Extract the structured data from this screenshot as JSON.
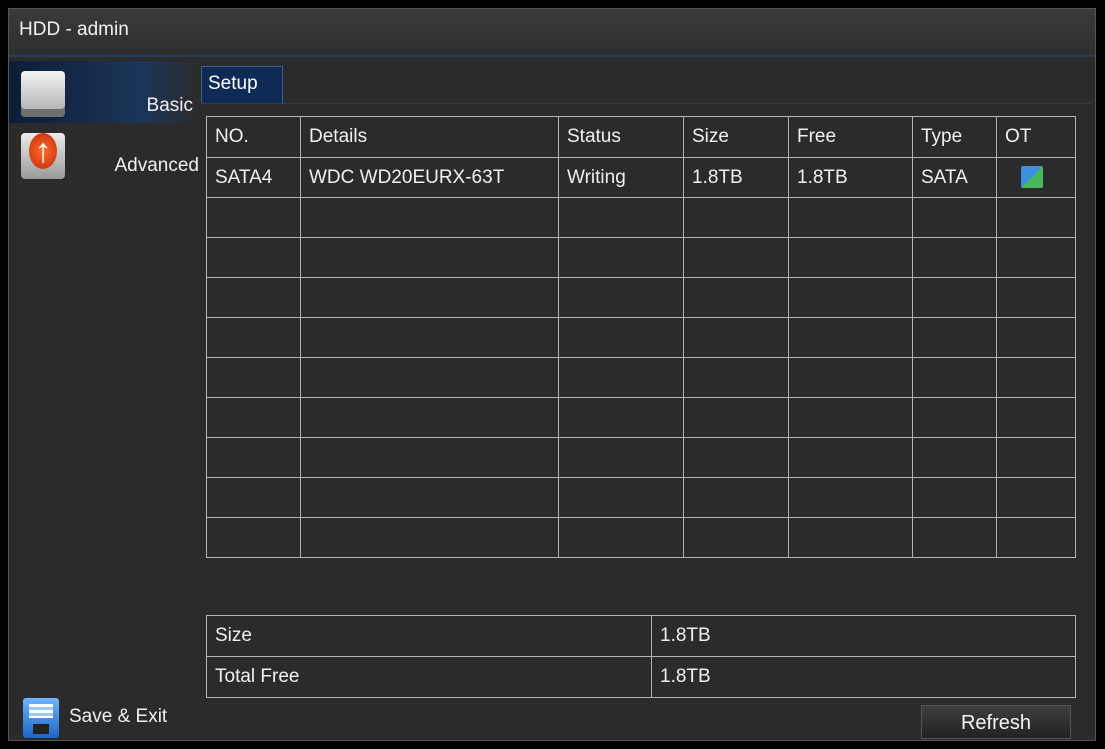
{
  "window": {
    "title": "HDD - admin"
  },
  "sidebar": {
    "items": [
      {
        "label": "Basic",
        "icon": "hdd-icon",
        "active": true
      },
      {
        "label": "Advanced",
        "icon": "upgrade-icon",
        "active": false
      }
    ],
    "save_exit_label": "Save & Exit"
  },
  "tabs": [
    {
      "label": "Setup"
    }
  ],
  "table": {
    "columns": [
      "NO.",
      "Details",
      "Status",
      "Size",
      "Free",
      "Type",
      "OT"
    ],
    "rows": [
      [
        "SATA4",
        "WDC WD20EURX-63T",
        "Writing",
        "1.8TB",
        "1.8TB",
        "SATA",
        ""
      ]
    ],
    "row_icon": "overwrite-icon",
    "total_rows": 10
  },
  "summary": [
    {
      "label": "Size",
      "value": "1.8TB"
    },
    {
      "label": "Total Free",
      "value": "1.8TB"
    }
  ],
  "buttons": {
    "refresh_label": "Refresh"
  }
}
